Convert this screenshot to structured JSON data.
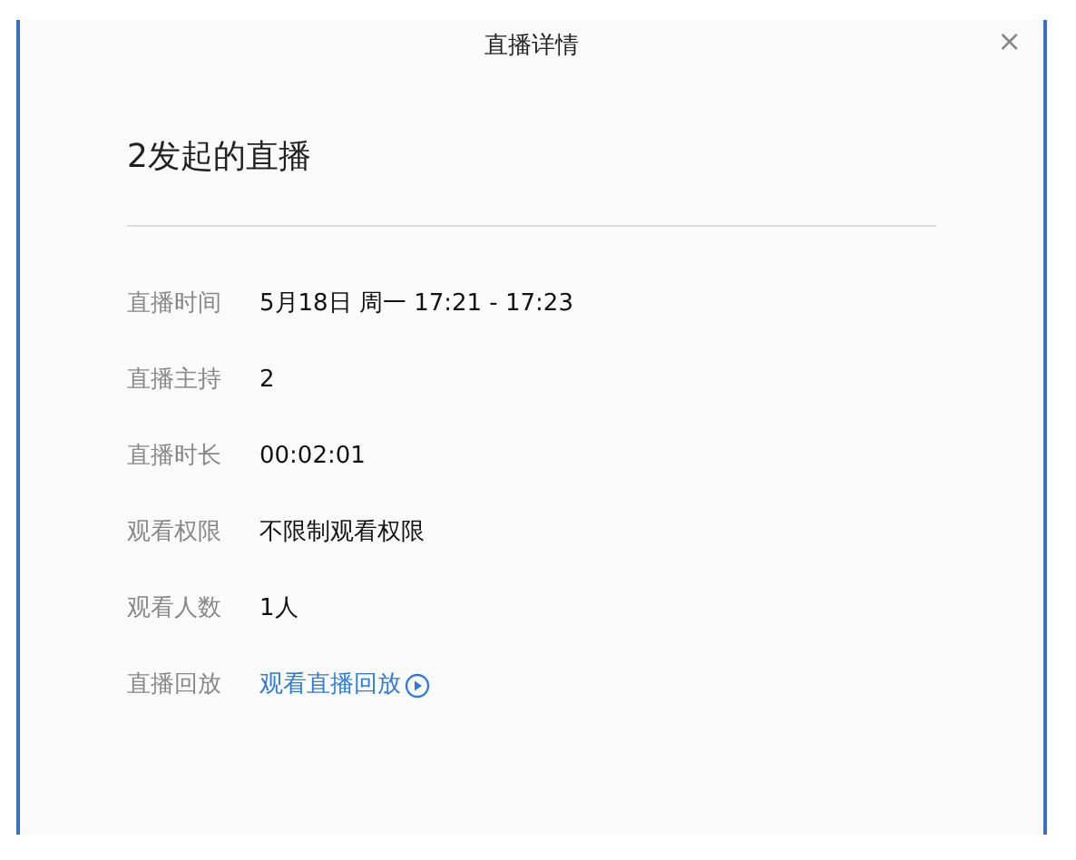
{
  "dialog": {
    "title": "直播详情",
    "close": "×"
  },
  "heading": "2发起的直播",
  "rows": [
    {
      "label": "直播时间",
      "value": "5月18日 周一 17:21 - 17:23",
      "kind": "text"
    },
    {
      "label": "直播主持",
      "value": "2",
      "kind": "text"
    },
    {
      "label": "直播时长",
      "value": "00:02:01",
      "kind": "text"
    },
    {
      "label": "观看权限",
      "value": "不限制观看权限",
      "kind": "text"
    },
    {
      "label": "观看人数",
      "value": "1人",
      "kind": "text"
    },
    {
      "label": "直播回放",
      "value": "观看直播回放",
      "kind": "link"
    }
  ]
}
